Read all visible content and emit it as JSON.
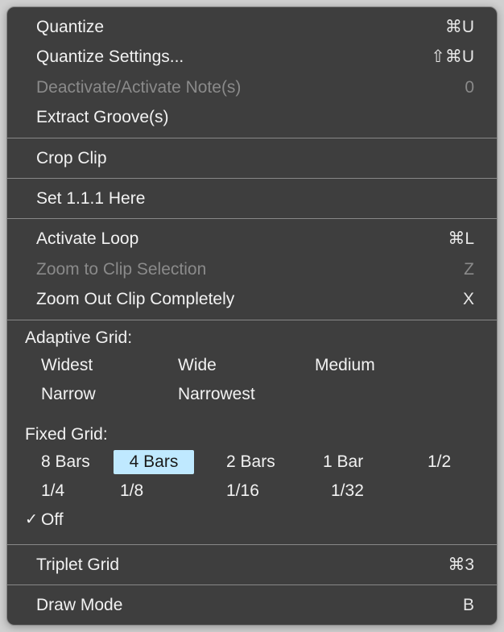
{
  "section1": {
    "quantize": {
      "label": "Quantize",
      "shortcut": "⌘U"
    },
    "quantize_settings": {
      "label": "Quantize Settings...",
      "shortcut": "⇧⌘U"
    },
    "deactivate_notes": {
      "label": "Deactivate/Activate Note(s)",
      "shortcut": "0"
    },
    "extract_groove": {
      "label": "Extract Groove(s)",
      "shortcut": ""
    }
  },
  "section2": {
    "crop_clip": {
      "label": "Crop Clip",
      "shortcut": ""
    }
  },
  "section3": {
    "set_111": {
      "label": "Set 1.1.1 Here",
      "shortcut": ""
    }
  },
  "section4": {
    "activate_loop": {
      "label": "Activate Loop",
      "shortcut": "⌘L"
    },
    "zoom_selection": {
      "label": "Zoom to Clip Selection",
      "shortcut": "Z"
    },
    "zoom_out": {
      "label": "Zoom Out Clip Completely",
      "shortcut": "X"
    }
  },
  "adaptive_grid": {
    "label": "Adaptive Grid:",
    "options": {
      "widest": "Widest",
      "wide": "Wide",
      "medium": "Medium",
      "narrow": "Narrow",
      "narrowest": "Narrowest"
    }
  },
  "fixed_grid": {
    "label": "Fixed Grid:",
    "options": {
      "bars8": "8 Bars",
      "bars4": "4 Bars",
      "bars2": "2 Bars",
      "bar1": "1 Bar",
      "half": "1/2",
      "quarter": "1/4",
      "eighth": "1/8",
      "sixteenth": "1/16",
      "thirtysecond": "1/32",
      "off": "Off"
    }
  },
  "section6": {
    "triplet": {
      "label": "Triplet Grid",
      "shortcut": "⌘3"
    }
  },
  "section7": {
    "draw": {
      "label": "Draw Mode",
      "shortcut": "B"
    }
  }
}
